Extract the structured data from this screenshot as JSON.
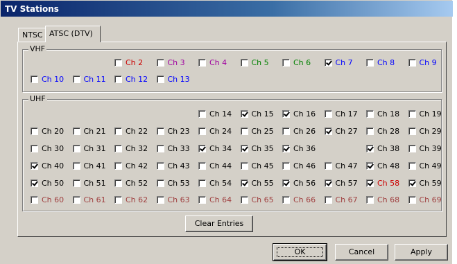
{
  "window": {
    "title": "TV Stations"
  },
  "tabs": [
    {
      "label": "NTSC",
      "selected": false
    },
    {
      "label": "ATSC (DTV)",
      "selected": true
    }
  ],
  "colors": {
    "black": "#000000",
    "red": "#cc0000",
    "purple": "#a000a0",
    "green": "#008000",
    "blue": "#0000ff",
    "darkred": "#a04040"
  },
  "vhf": {
    "label": "VHF",
    "rows": [
      [
        {
          "label": "Ch 2",
          "checked": false,
          "color": "red"
        },
        {
          "label": "Ch 3",
          "checked": false,
          "color": "purple"
        },
        {
          "label": "Ch 4",
          "checked": false,
          "color": "purple"
        },
        {
          "label": "Ch 5",
          "checked": false,
          "color": "green"
        },
        {
          "label": "Ch 6",
          "checked": false,
          "color": "green"
        },
        {
          "label": "Ch 7",
          "checked": true,
          "color": "blue"
        },
        {
          "label": "Ch 8",
          "checked": false,
          "color": "blue"
        },
        {
          "label": "Ch 9",
          "checked": false,
          "color": "blue"
        }
      ],
      [
        {
          "label": "Ch 10",
          "checked": false,
          "color": "blue"
        },
        {
          "label": "Ch 11",
          "checked": false,
          "color": "blue"
        },
        {
          "label": "Ch 12",
          "checked": false,
          "color": "blue"
        },
        {
          "label": "Ch 13",
          "checked": false,
          "color": "blue"
        }
      ]
    ]
  },
  "uhf": {
    "label": "UHF",
    "rows": [
      [
        null,
        null,
        null,
        null,
        {
          "label": "Ch 14",
          "checked": false,
          "color": "black"
        },
        {
          "label": "Ch 15",
          "checked": true,
          "color": "black"
        },
        {
          "label": "Ch 16",
          "checked": true,
          "color": "black"
        },
        {
          "label": "Ch 17",
          "checked": false,
          "color": "black"
        },
        {
          "label": "Ch 18",
          "checked": false,
          "color": "black"
        },
        {
          "label": "Ch 19",
          "checked": false,
          "color": "black"
        }
      ],
      [
        {
          "label": "Ch 20",
          "checked": false,
          "color": "black"
        },
        {
          "label": "Ch 21",
          "checked": false,
          "color": "black"
        },
        {
          "label": "Ch 22",
          "checked": false,
          "color": "black"
        },
        {
          "label": "Ch 23",
          "checked": false,
          "color": "black"
        },
        {
          "label": "Ch 24",
          "checked": false,
          "color": "black"
        },
        {
          "label": "Ch 25",
          "checked": false,
          "color": "black"
        },
        {
          "label": "Ch 26",
          "checked": false,
          "color": "black"
        },
        {
          "label": "Ch 27",
          "checked": true,
          "color": "black"
        },
        {
          "label": "Ch 28",
          "checked": false,
          "color": "black"
        },
        {
          "label": "Ch 29",
          "checked": false,
          "color": "black"
        }
      ],
      [
        {
          "label": "Ch 30",
          "checked": false,
          "color": "black"
        },
        {
          "label": "Ch 31",
          "checked": false,
          "color": "black"
        },
        {
          "label": "Ch 32",
          "checked": false,
          "color": "black"
        },
        {
          "label": "Ch 33",
          "checked": false,
          "color": "black"
        },
        {
          "label": "Ch 34",
          "checked": true,
          "color": "black"
        },
        {
          "label": "Ch 35",
          "checked": true,
          "color": "black"
        },
        {
          "label": "Ch 36",
          "checked": true,
          "color": "black"
        },
        null,
        {
          "label": "Ch 38",
          "checked": true,
          "color": "black"
        },
        {
          "label": "Ch 39",
          "checked": false,
          "color": "black"
        }
      ],
      [
        {
          "label": "Ch 40",
          "checked": true,
          "color": "black"
        },
        {
          "label": "Ch 41",
          "checked": false,
          "color": "black"
        },
        {
          "label": "Ch 42",
          "checked": false,
          "color": "black"
        },
        {
          "label": "Ch 43",
          "checked": false,
          "color": "black"
        },
        {
          "label": "Ch 44",
          "checked": false,
          "color": "black"
        },
        {
          "label": "Ch 45",
          "checked": false,
          "color": "black"
        },
        {
          "label": "Ch 46",
          "checked": false,
          "color": "black"
        },
        {
          "label": "Ch 47",
          "checked": false,
          "color": "black"
        },
        {
          "label": "Ch 48",
          "checked": true,
          "color": "black"
        },
        {
          "label": "Ch 49",
          "checked": false,
          "color": "black"
        }
      ],
      [
        {
          "label": "Ch 50",
          "checked": true,
          "color": "black"
        },
        {
          "label": "Ch 51",
          "checked": false,
          "color": "black"
        },
        {
          "label": "Ch 52",
          "checked": false,
          "color": "black"
        },
        {
          "label": "Ch 53",
          "checked": false,
          "color": "black"
        },
        {
          "label": "Ch 54",
          "checked": false,
          "color": "black"
        },
        {
          "label": "Ch 55",
          "checked": true,
          "color": "black"
        },
        {
          "label": "Ch 56",
          "checked": true,
          "color": "black"
        },
        {
          "label": "Ch 57",
          "checked": true,
          "color": "black"
        },
        {
          "label": "Ch 58",
          "checked": true,
          "color": "red"
        },
        {
          "label": "Ch 59",
          "checked": true,
          "color": "black"
        }
      ],
      [
        {
          "label": "Ch 60",
          "checked": false,
          "color": "darkred"
        },
        {
          "label": "Ch 61",
          "checked": false,
          "color": "darkred"
        },
        {
          "label": "Ch 62",
          "checked": false,
          "color": "darkred"
        },
        {
          "label": "Ch 63",
          "checked": false,
          "color": "darkred"
        },
        {
          "label": "Ch 64",
          "checked": false,
          "color": "darkred"
        },
        {
          "label": "Ch 65",
          "checked": false,
          "color": "darkred"
        },
        {
          "label": "Ch 66",
          "checked": false,
          "color": "darkred"
        },
        {
          "label": "Ch 67",
          "checked": false,
          "color": "darkred"
        },
        {
          "label": "Ch 68",
          "checked": false,
          "color": "darkred"
        },
        {
          "label": "Ch 69",
          "checked": false,
          "color": "darkred"
        }
      ]
    ]
  },
  "buttons": {
    "clear_entries": "Clear Entries",
    "ok": "OK",
    "cancel": "Cancel",
    "apply": "Apply"
  }
}
